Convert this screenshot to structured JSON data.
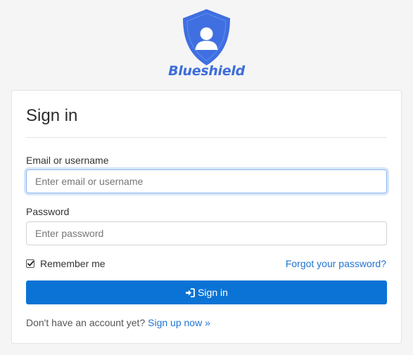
{
  "brand": {
    "name": "Blueshield",
    "logo_icon": "shield-user-icon",
    "accent": "#3d6ed8"
  },
  "form": {
    "title": "Sign in",
    "email": {
      "label": "Email or username",
      "placeholder": "Enter email or username",
      "value": ""
    },
    "password": {
      "label": "Password",
      "placeholder": "Enter password",
      "value": ""
    },
    "remember": {
      "label": "Remember me",
      "checked": true
    },
    "forgot_link": "Forgot your password?",
    "submit": {
      "label": "Sign in",
      "icon": "sign-in-icon",
      "color": "#0b73d6"
    },
    "signup": {
      "prompt": "Don't have an account yet?",
      "link": "Sign up now »"
    }
  }
}
